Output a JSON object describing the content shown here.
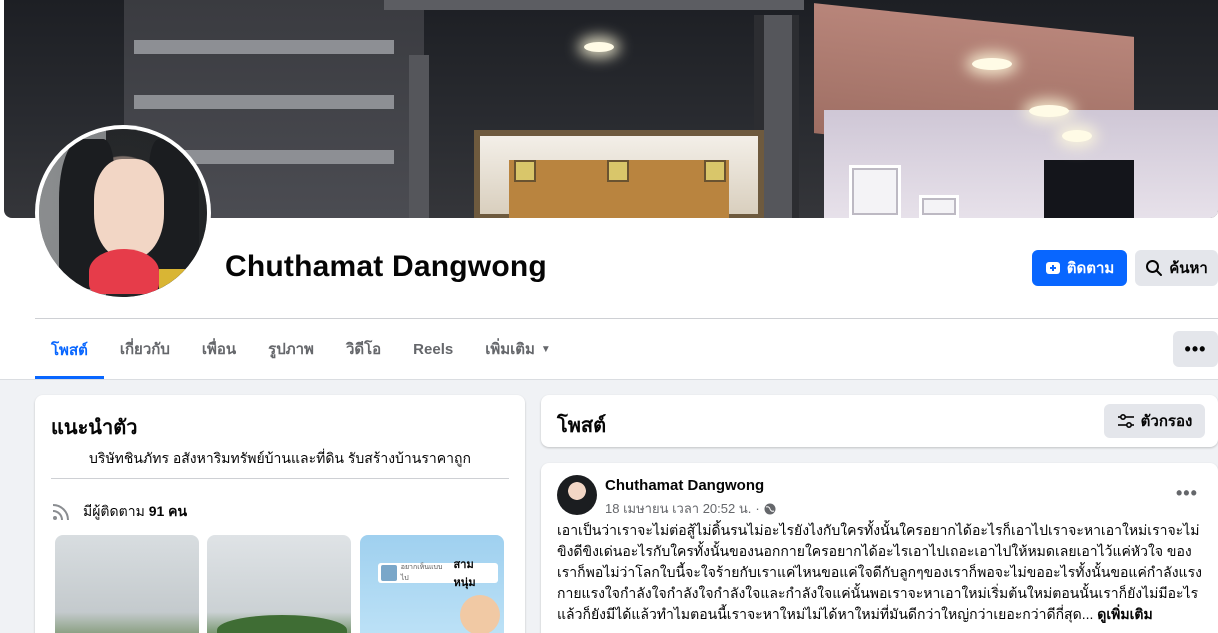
{
  "profile": {
    "name": "Chuthamat Dangwong"
  },
  "actions": {
    "follow_label": "ติดตาม",
    "search_label": "ค้นหา",
    "more_label": "•••"
  },
  "tabs": [
    {
      "label": "โพสต์"
    },
    {
      "label": "เกี่ยวกับ"
    },
    {
      "label": "เพื่อน"
    },
    {
      "label": "รูปภาพ"
    },
    {
      "label": "วิดีโอ"
    },
    {
      "label": "Reels"
    },
    {
      "label": "เพิ่มเติม"
    }
  ],
  "intro": {
    "title": "แนะนำตัว",
    "bio": "บริษัทชินภัทร อสังหาริมทรัพย์บ้านและที่ดิน รับสร้างบ้านราคาถูก",
    "followers_prefix": "มีผู้ติดตาม",
    "followers_count": "91",
    "followers_suffix": "คน",
    "photo3_small_text": "อยากเห็นแบบไป",
    "photo3_tag": "สามหนุ่ม"
  },
  "posts": {
    "title": "โพสต์",
    "filter_label": "ตัวกรอง",
    "items": [
      {
        "author": "Chuthamat Dangwong",
        "timestamp": "18 เมษายน เวลา 20:52 น.",
        "separator": "·",
        "text": "เอาเป็นว่าเราจะไม่ต่อสู้ไม่ดิ้นรนไม่อะไรยังไงกับใครทั้งนั้นใครอยากได้อะไรก็เอาไปเราจะหาเอาใหม่เราจะไม่ขิงดีขิงเด่นอะไรกับใครทั้งนั้นของนอกกายใครอยากได้อะไรเอาไปเถอะเอาไปให้หมดเลยเอาไว้แค่หัวใจ ของเราก็พอไม่ว่าโลกใบนี้จะใจร้ายกับเราแค่ไหนขอแค่ใจดีกับลูกๆของเราก็พอจะไม่ขออะไรทั้งนั้นขอแค่กำลังแรงกายแรงใจกำลังใจกำลังใจกำลังใจและกำลังใจแค่นั้นพอเราจะหาเอาใหม่เริ่มต้นใหม่ตอนนั้นเราก็ยังไม่มีอะไรแล้วก็ยังมีได้แล้วทำไมตอนนี้เราจะหาใหม่ไม่ได้หาใหม่ที่มันดีกว่าใหญ่กว่าเยอะกว่าดีกี่สุด...",
        "see_more": "ดูเพิ่มเติม",
        "menu_label": "•••"
      }
    ]
  },
  "colors": {
    "accent": "#0866ff",
    "background": "#f0f2f5",
    "button_gray": "#e4e6eb",
    "secondary_text": "#65676b"
  }
}
